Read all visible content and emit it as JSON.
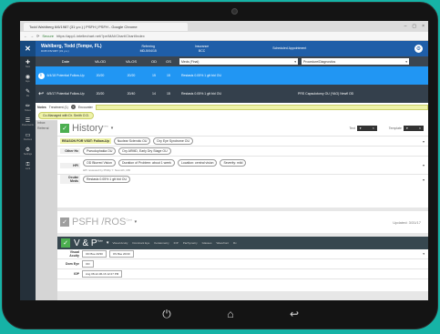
{
  "browser": {
    "tab_title": "Todd Wahlberg 6/6/1987 (31 y.o.) | PSFH | PSFH - Google Chrome",
    "window_controls": [
      "–",
      "▢",
      "×"
    ],
    "secure_label": "Secure",
    "url": "https://app1.intellechart.net/?pe/MAI/Chart/Chart/Index",
    "nav_icons": [
      "arrow-left-icon",
      "arrow-right-icon",
      "reload-icon"
    ]
  },
  "app": {
    "logo": "✕",
    "patient": "Wahlberg, Todd (Tempe, FL)",
    "patient_sub": "DOB 6/6/1987 (31 y.o.)",
    "head_cols": [
      {
        "label": "Referring",
        "value": "MD-5/04/15"
      },
      {
        "label": "Insurance",
        "value": "BCC"
      },
      {
        "label": "Scheduled Appointment",
        "value": ""
      }
    ],
    "accent": "#1f5ea8"
  },
  "sidebar": [
    {
      "icon": "plus-icon",
      "glyph": "✚",
      "label": "New"
    },
    {
      "icon": "eye-icon",
      "glyph": "◉",
      "label": "Eye"
    },
    {
      "icon": "checklist-icon",
      "glyph": "✎",
      "label": "Rx"
    },
    {
      "icon": "pencil-icon",
      "glyph": "✏",
      "label": "Notes"
    },
    {
      "icon": "list-icon",
      "glyph": "☰",
      "label": "Documents"
    },
    {
      "icon": "monitor-icon",
      "glyph": "▭",
      "label": "Devices"
    },
    {
      "icon": "settings-icon",
      "glyph": "⚙",
      "label": "Settings"
    },
    {
      "icon": "lock-icon",
      "glyph": "🔒",
      "label": "Lock"
    }
  ],
  "table": {
    "headers": [
      "Date",
      "VA-OD",
      "VA-OS",
      "OD",
      "OS",
      "Meds (Final)",
      "Procedure/Diagnostics"
    ],
    "dd_left": "Meds (Final)",
    "dd_right": "Procedure/Diagnostics",
    "rows": [
      {
        "icon": "info-icon",
        "glyph": "i",
        "date": "6/4/18 Potential Follow-Up",
        "vaod": "20/20",
        "vaos": "20/20",
        "od": "15",
        "os": "15",
        "meds": "Restasis 0.05% 1 gtt bid OU",
        "proc": ""
      },
      {
        "icon": "reply-icon",
        "glyph": "↩",
        "date": "6/5/17 Potential Follow-Up",
        "vaod": "20/20",
        "vaos": "20/40",
        "od": "14",
        "os": "15",
        "meds": "Restasis 0.05% 1 gtt bid OU",
        "proc": "PRS Capsulotomy OU (YAG) Newfl OD"
      }
    ]
  },
  "notes": {
    "label": "Notes",
    "treatment": "Treatment (1)",
    "enc_label": "Encounter",
    "managed_pill": "Co-Managed with Dr. Smith O.D."
  },
  "left_summary": [
    "Inbox",
    "Referral"
  ],
  "history": {
    "title": "History",
    "sup": "new",
    "dd": "▾",
    "mini_left_label": "Text",
    "mini_right_label": "Template",
    "rows": [
      {
        "label": "REASON FOR VISIT: Follow-Up",
        "pills": [
          "Nuclear Sclerotic OU",
          "Dry Eye Syndrome OU"
        ]
      },
      {
        "label": "Other Hx",
        "pills": [
          "Pseudophakia OU",
          "Dry ARMD, Early Dry Stage OU"
        ]
      },
      {
        "label": "HPI",
        "pills": [
          "OD Blurred Vision",
          "Duration of Problem: about 1 week",
          "Location: central vision",
          "Severity: mild"
        ],
        "note": "HPI reviewed by Phillip Y. Nesmith, MD"
      },
      {
        "label": "Ocular Meds",
        "pills": [
          "Restasis 0.05% 1 gtt bid OU"
        ]
      }
    ]
  },
  "psfh": {
    "title": "PSFH",
    "sep": "/",
    "ros": "ROS",
    "sup": "Cont",
    "updated": "Updated: 3/31/17"
  },
  "vp": {
    "title": "V & P",
    "sup": "Note",
    "tabs": [
      "Visual Acuity",
      "Dominant Eye",
      "Keratometry",
      "IOP",
      "Pachymetry",
      "Glasses",
      "Wavefront",
      "Rx"
    ],
    "rows": [
      {
        "label": "Visual Acuity",
        "values": [
          "OD  Bse 20/30",
          "OS  Bse 20/40"
        ]
      },
      {
        "label": "Dom Eye",
        "values": [
          "OD"
        ]
      },
      {
        "label": "IOP",
        "values": [
          "Ang 08-12-06-16 12:27 PM"
        ]
      }
    ]
  },
  "android_nav": [
    "⏻",
    "⌂",
    "↩"
  ]
}
